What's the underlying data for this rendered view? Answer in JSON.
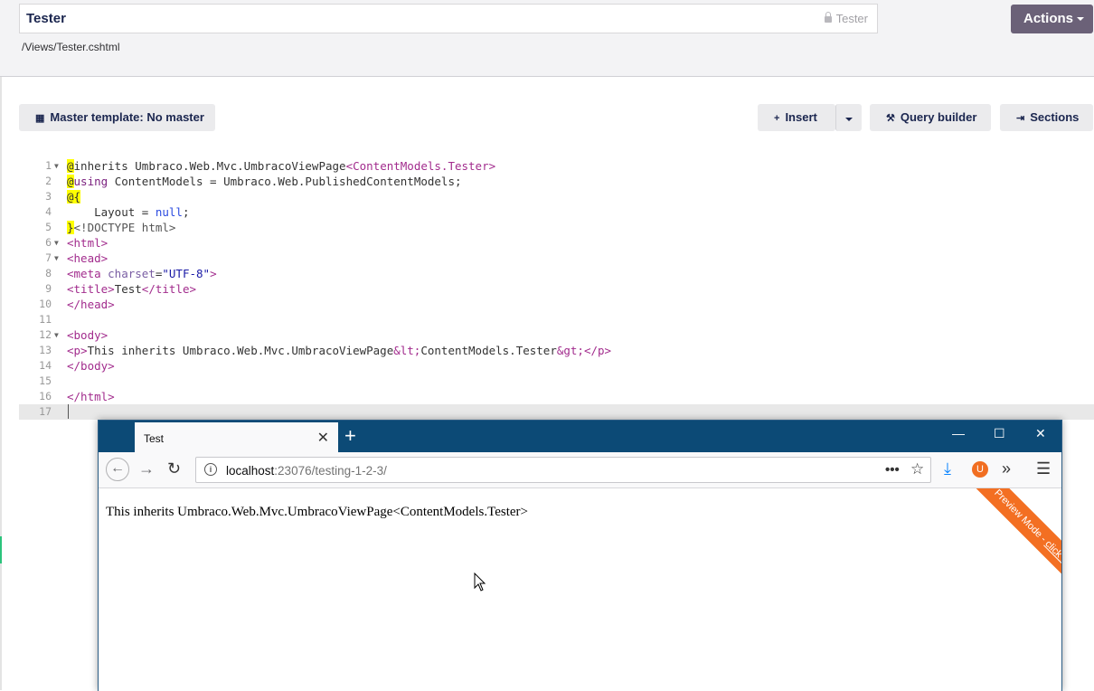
{
  "header": {
    "name_value": "Tester",
    "alias": "Tester",
    "path": "/Views/Tester.cshtml",
    "actions_label": "Actions"
  },
  "toolbar": {
    "master_label": "Master template:",
    "master_value": "No master",
    "insert_label": "Insert",
    "query_builder_label": "Query builder",
    "sections_label": "Sections"
  },
  "editor": {
    "line_numbers": [
      "1",
      "2",
      "3",
      "4",
      "5",
      "6",
      "7",
      "8",
      "9",
      "10",
      "11",
      "12",
      "13",
      "14",
      "15",
      "16",
      "17"
    ],
    "lines": {
      "l1a": "@",
      "l1b": "inherits Umbraco.Web.Mvc.UmbracoViewPage",
      "l1c": "<ContentModels.Tester>",
      "l2a": "@",
      "l2b": "using",
      "l2c": " ContentModels = Umbraco.Web.PublishedContentModels;",
      "l3a": "@{",
      "l4a": "    Layout = ",
      "l4b": "null",
      "l4c": ";",
      "l5a": "}",
      "l5b": "<!DOCTYPE html>",
      "l6": "<html>",
      "l7": "<head>",
      "l8a": "<meta ",
      "l8b": "charset",
      "l8c": "=",
      "l8d": "\"UTF-8\"",
      "l8e": ">",
      "l9a": "<title>",
      "l9b": "Test",
      "l9c": "</title>",
      "l10": "</head>",
      "l12": "<body>",
      "l13a": "<p>",
      "l13b": "This inherits Umbraco.Web.Mvc.UmbracoViewPage",
      "l13c": "&lt;",
      "l13d": "ContentModels.Tester",
      "l13e": "&gt;",
      "l13f": "</p>",
      "l14": "</body>",
      "l16": "</html>"
    }
  },
  "browser": {
    "tab_title": "Test",
    "url_host": "localhost",
    "url_path": ":23076/testing-1-2-3/",
    "page_text": "This inherits Umbraco.Web.Mvc.UmbracoViewPage<ContentModels.Tester>",
    "ribbon_text": "Preview Mode - ",
    "ribbon_link": "click to end",
    "ribbon_color": "#f36f22",
    "titlebar_color": "#0c4a76"
  }
}
